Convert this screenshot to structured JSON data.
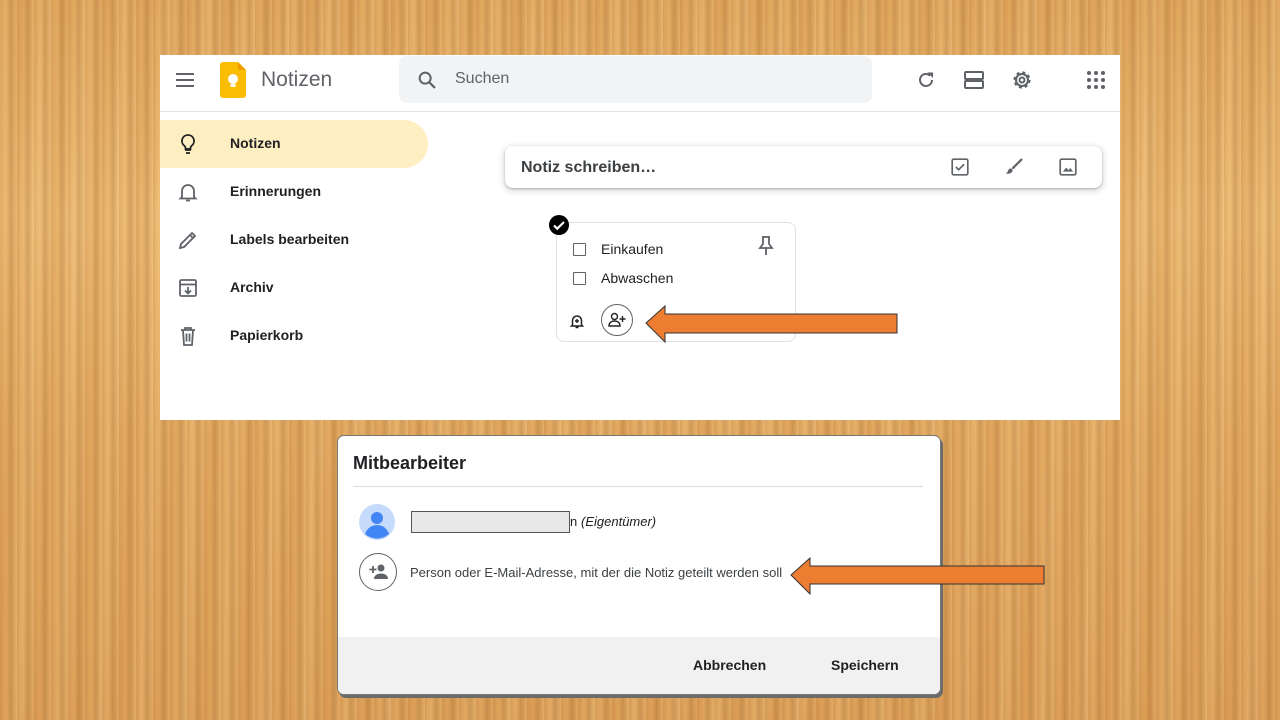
{
  "app": {
    "title": "Notizen",
    "search_placeholder": "Suchen"
  },
  "toolbar": {
    "icons": [
      "refresh-icon",
      "list-view-icon",
      "settings-icon",
      "apps-grid-icon"
    ]
  },
  "sidebar": {
    "items": [
      {
        "label": "Notizen",
        "icon": "lightbulb-icon",
        "active": true
      },
      {
        "label": "Erinnerungen",
        "icon": "bell-icon",
        "active": false
      },
      {
        "label": "Labels bearbeiten",
        "icon": "pencil-icon",
        "active": false
      },
      {
        "label": "Archiv",
        "icon": "archive-icon",
        "active": false
      },
      {
        "label": "Papierkorb",
        "icon": "trash-icon",
        "active": false
      }
    ]
  },
  "take_note": {
    "placeholder": "Notiz schreiben…",
    "icons": [
      "new-list-icon",
      "brush-icon",
      "image-icon"
    ]
  },
  "note": {
    "items": [
      {
        "label": "Einkaufen",
        "checked": false
      },
      {
        "label": "Abwaschen",
        "checked": false
      }
    ]
  },
  "dialog": {
    "title": "Mitbearbeiter",
    "owner": {
      "name_tail": "n",
      "role": "(Eigentümer)"
    },
    "share_placeholder": "Person oder E-Mail-Adresse, mit der die Notiz geteilt werden soll",
    "cancel_label": "Abbrechen",
    "save_label": "Speichern"
  },
  "colors": {
    "accent": "#feefc3",
    "arrow": "#ed7d31",
    "logo": "#fbbc04"
  }
}
